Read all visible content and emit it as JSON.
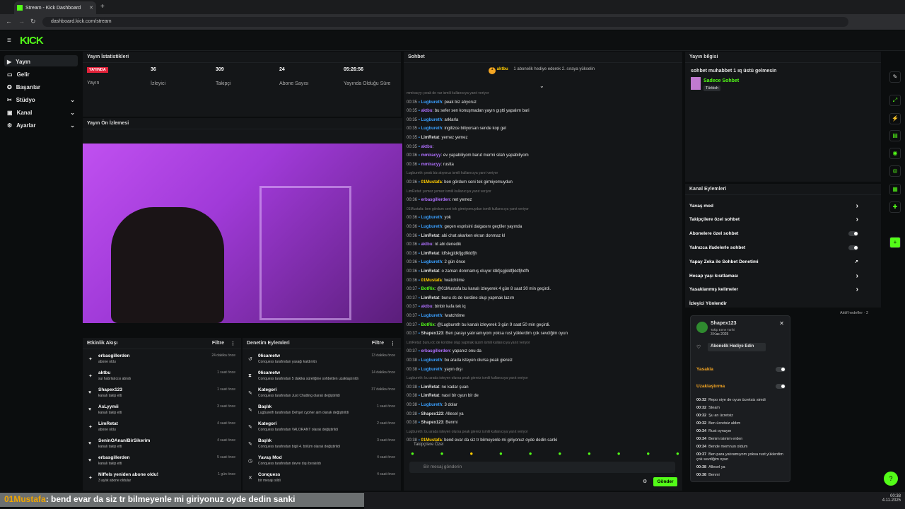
{
  "browser": {
    "tab_title": "Stream - Kick Dashboard",
    "url": "dashboard.kick.com/stream"
  },
  "brand": {
    "logo": "KICK",
    "accent": "#53fc18"
  },
  "sidebar": {
    "items": [
      {
        "label": "Yayın"
      },
      {
        "label": "Gelir"
      },
      {
        "label": "Başarılar"
      },
      {
        "label": "Stüdyo"
      },
      {
        "label": "Kanal"
      },
      {
        "label": "Ayarlar"
      }
    ]
  },
  "stats": {
    "title": "Yayın İstatistikleri",
    "badge": "YAYINDA",
    "items": [
      {
        "value": "",
        "label": "Yayın"
      },
      {
        "value": "36",
        "label": "İzleyici"
      },
      {
        "value": "309",
        "label": "Takipçi"
      },
      {
        "value": "24",
        "label": "Abone Sayısı"
      },
      {
        "value": "05:26:56",
        "label": "Yayında Olduğu Süre"
      }
    ]
  },
  "preview": {
    "title": "Yayın Ön İzlemesi"
  },
  "activity": {
    "title": "Etkinlik Akışı",
    "filter": "Filtre",
    "items": [
      {
        "name": "erbasgillerden",
        "sub": "abone oldu",
        "time": "24 dakika önce",
        "icon": "✦"
      },
      {
        "name": "aktbu",
        "sub": "sui habrlatıcısı abndı",
        "time": "1 saat önce",
        "icon": "✦"
      },
      {
        "name": "Shapex123",
        "sub": "kanalı takip etti",
        "time": "1 saat önce",
        "icon": "♥"
      },
      {
        "name": "AsLyymii",
        "sub": "kanalı takip etti",
        "time": "3 saat önce",
        "icon": "♥"
      },
      {
        "name": "LimRetat",
        "sub": "abone oldu",
        "time": "4 saat önce",
        "icon": "✦"
      },
      {
        "name": "SeninOAnaniBirSikerim",
        "sub": "kanalı takip etti",
        "time": "4 saat önce",
        "icon": "♥"
      },
      {
        "name": "erbasgillerden",
        "sub": "kanalı takip etti",
        "time": "5 saat önce",
        "icon": "♥"
      },
      {
        "name": "Niffels yeniden abone oldu!",
        "sub": "3 aylık abone oldular",
        "time": "1 gün önce",
        "icon": "✦"
      }
    ]
  },
  "moderation": {
    "title": "Denetim Eylemleri",
    "filter": "Filtre",
    "items": [
      {
        "name": "06sametw",
        "sub": "Conquess tarafından yasağı kaldırıldı",
        "time": "13 dakika önce",
        "icon": "↺"
      },
      {
        "name": "06sametw",
        "sub": "Conquess tarafından 5 dakika süreliğine sohbetten uzaklaştırıldı",
        "time": "14 dakika önce",
        "icon": "⧗"
      },
      {
        "name": "Kategori",
        "sub": "Conquess tarafından Just Chatting olarak değiştirildi",
        "time": "37 dakika önce",
        "icon": "✎"
      },
      {
        "name": "Başlık",
        "sub": "Lugbureth tarafından Dehşet cypher aim olarak değiştirildi",
        "time": "1 saat önce",
        "icon": "✎"
      },
      {
        "name": "Kategori",
        "sub": "Conquess tarafından VALORANT olarak değiştirildi",
        "time": "2 saat önce",
        "icon": "✎"
      },
      {
        "name": "Başlık",
        "sub": "Conquess tarafından bigli 4. bölüm olarak değiştirildi",
        "time": "3 saat önce",
        "icon": "✎"
      },
      {
        "name": "Yavaş Mod",
        "sub": "Conquess tarafından devre dışı bırakıldı",
        "time": "4 saat önce",
        "icon": "◷"
      },
      {
        "name": "Conquess",
        "sub": "bir mesajı sildi",
        "time": "4 saat önce",
        "icon": "✕"
      }
    ]
  },
  "chat": {
    "title": "Sohbet",
    "pinned_user": "aktbu",
    "pinned_count": "1",
    "pinned_text": "1 abonelik hediye ederek 2. sıraya yükselin",
    "messages": [
      {
        "sys": "mmiracyy: peak de var ismili kullanıcıya yanıt veriyor"
      },
      {
        "time": "00:35",
        "user": "Lugbureth",
        "color": "#3aa0ff",
        "text": "peak biz atıyoruz"
      },
      {
        "time": "00:35",
        "user": "aktbu",
        "color": "#b070ff",
        "text": "bu sefer sen konuşmadan yayın gıştti yapalım bari"
      },
      {
        "time": "00:35",
        "user": "Lugbureth",
        "color": "#3aa0ff",
        "text": "arklarla"
      },
      {
        "time": "00:35",
        "user": "Lugbureth",
        "color": "#3aa0ff",
        "text": "ingilizce biliyorsan sende kop gel"
      },
      {
        "time": "00:35",
        "user": "LimRetat",
        "color": "#ddd",
        "text": "yemez yemez"
      },
      {
        "time": "00:35",
        "user": "aktbu",
        "color": "#b070ff",
        "text": ""
      },
      {
        "time": "00:36",
        "user": "mmiracyy",
        "color": "#b070ff",
        "text": "ev yapabiliyom barut mermi silah yapabiliyom"
      },
      {
        "time": "00:36",
        "user": "mmiracyy",
        "color": "#b070ff",
        "text": "rustta"
      },
      {
        "sys": "Lugbureth: peak biz atıyoruz ismili kullanıcıya yanıt veriyor"
      },
      {
        "time": "00:36",
        "user": "01Mustafa",
        "color": "#ffcc00",
        "text": "ben gördum seni tek girmiyomuydun"
      },
      {
        "sys": "LimRetat: yemez yemez ismili kullanıcıya yanıt veriyor"
      },
      {
        "time": "00:36",
        "user": "erbasgillerden",
        "color": "#b070ff",
        "text": "net yemez"
      },
      {
        "sys": "01Mustafa: ben gördum seni tek girmiyomuydun ismili kullanıcıya yanıt veriyor"
      },
      {
        "time": "00:36",
        "user": "Lugbureth",
        "color": "#3aa0ff",
        "text": "yok"
      },
      {
        "time": "00:36",
        "user": "Lugbureth",
        "color": "#3aa0ff",
        "text": "geçen esprisini dalgasını geçtiler yayında"
      },
      {
        "time": "00:36",
        "user": "LimRetat",
        "color": "#ddd",
        "text": "abi chat akarken ekran donmaz kl"
      },
      {
        "time": "00:36",
        "user": "aktbu",
        "color": "#b070ff",
        "text": "nt abi denedik"
      },
      {
        "time": "00:36",
        "user": "LimRetat",
        "color": "#ddd",
        "text": "ldfskgjldkfjgdfkldfjh"
      },
      {
        "time": "00:36",
        "user": "Lugbureth",
        "color": "#3aa0ff",
        "text": "2 gün önce"
      },
      {
        "time": "00:36",
        "user": "LimRetat",
        "color": "#ddd",
        "text": "o zaman donmamış oluyor ldkfjsgjkldfjkldfjhdfh"
      },
      {
        "time": "00:36",
        "user": "01Mustafa",
        "color": "#ffcc00",
        "text": "!watchtime"
      },
      {
        "time": "00:37",
        "user": "BotRix",
        "color": "#53fc18",
        "text": "@01Mustafa bu kanalı izleyerek 4 gün 8 saat 30 min geçirdi."
      },
      {
        "time": "00:37",
        "user": "LimRetat",
        "color": "#ddd",
        "text": "bunu dc de kordine olup yapmak lazım"
      },
      {
        "time": "00:37",
        "user": "aktbu",
        "color": "#b070ff",
        "text": "binbir kafa tek iq"
      },
      {
        "time": "00:37",
        "user": "Lugbureth",
        "color": "#3aa0ff",
        "text": "!watchtime"
      },
      {
        "time": "00:37",
        "user": "BotRix",
        "color": "#53fc18",
        "text": "@Lugbureth bu kanalı izleyerek 3 gün 9 saat 50 min geçirdi."
      },
      {
        "time": "00:37",
        "user": "Shapex123",
        "color": "#ddd",
        "text": "Ben parayı yatırıamıyom yoksa rust yüklerdim çok sevdiğim oyun"
      },
      {
        "sys": "LimRetat: bunu dc de kordine olup yapmak lazım ismili kullanıcıya yanıt veriyor"
      },
      {
        "time": "00:37",
        "user": "erbasgillerden",
        "color": "#b070ff",
        "text": "yapanız onu da"
      },
      {
        "time": "00:38",
        "user": "Lugbureth",
        "color": "#3aa0ff",
        "text": "bu arada isteyen olursa peak giereiz"
      },
      {
        "time": "00:38",
        "user": "Lugbureth",
        "color": "#3aa0ff",
        "text": "yayın dışı"
      },
      {
        "sys": "Lugbureth: bu arada isteyen olursa peak giereiz ismili kullanıcıya yanıt veriyor"
      },
      {
        "time": "00:38",
        "user": "LimRetat",
        "color": "#ddd",
        "text": "ne kadar şuan"
      },
      {
        "time": "00:38",
        "user": "LimRetat",
        "color": "#ddd",
        "text": "nasıl bir oyun bir de"
      },
      {
        "time": "00:38",
        "user": "Lugbureth",
        "color": "#3aa0ff",
        "text": "3 dolar"
      },
      {
        "time": "00:38",
        "user": "Shapex123",
        "color": "#ddd",
        "text": "Allesel ya"
      },
      {
        "time": "00:38",
        "user": "Shapex123",
        "color": "#ddd",
        "text": "Benmi"
      },
      {
        "sys": "Lugbureth: bu arada isteyen olursa peak giereiz ismili kullanıcıya yanıt veriyor"
      },
      {
        "time": "00:38",
        "user": "01Mustafa",
        "color": "#ffcc00",
        "text": "bend evar da siz tr bilmeyenle mi giriyonuz oyde dedin sanki"
      }
    ],
    "followers_label": "Takipçilere Özel",
    "input_placeholder": "Bir mesaj gönderin",
    "send": "Gönder"
  },
  "info": {
    "title": "Yayın bilgisi",
    "stream_title": "sohbet muhabbet 1 ıq üstü gelmesin",
    "category": "Sadece Sohbet",
    "language": "Türkish"
  },
  "channel_actions": {
    "title": "Kanal Eylemleri",
    "items": [
      {
        "label": "Yavaş mod",
        "kind": "arrow"
      },
      {
        "label": "Takipçilere özel sohbet",
        "kind": "arrow"
      },
      {
        "label": "Abonelere özel sohbet",
        "kind": "toggle"
      },
      {
        "label": "Yalnızca ifadelerle sohbet",
        "kind": "toggle"
      },
      {
        "label": "Yapay Zeka ile Sohbet Denetimi",
        "kind": "link"
      },
      {
        "label": "Hesap yaşı kısıtlaması",
        "kind": "arrow"
      },
      {
        "label": "Yasaklanmış kelimeler",
        "kind": "arrow"
      },
      {
        "label": "İzleyici Yönlendir",
        "kind": "none"
      }
    ],
    "goals": "Aktif hedefler · 2"
  },
  "user_card": {
    "name": "Shapex123",
    "follow_label": "Takip Etme Tarihi",
    "follow_date": "3 Kas 2025",
    "gift": "Abonelik Hediye Edin",
    "ban": "Yasakla",
    "timeout": "Uzaklaştırma",
    "history": [
      {
        "time": "00:32",
        "text": "Repo oiye de oyun ücretsiz simdi"
      },
      {
        "time": "00:32",
        "text": "Steam"
      },
      {
        "time": "00:32",
        "text": "Şu an ücretsiz"
      },
      {
        "time": "00:32",
        "text": "Ben ücretsiz aldım"
      },
      {
        "time": "00:34",
        "text": "Rust oynayın"
      },
      {
        "time": "00:34",
        "text": "Benim isimim erden"
      },
      {
        "time": "00:34",
        "text": "Bende memnun oldum"
      },
      {
        "time": "00:37",
        "text": "Ben para yatıramıyom yoksa rust yüklerdim çok sevdiğim oyun"
      },
      {
        "time": "00:38",
        "text": "Allesel ya"
      },
      {
        "time": "00:38",
        "text": "Benmi"
      }
    ]
  },
  "caption": {
    "user": "01Mustafa",
    "text": ": bend evar da siz tr bilmeyenle mi giriyonuz oyde dedin sanki"
  },
  "clock": {
    "time": "00:38",
    "date": "4.11.2025"
  }
}
